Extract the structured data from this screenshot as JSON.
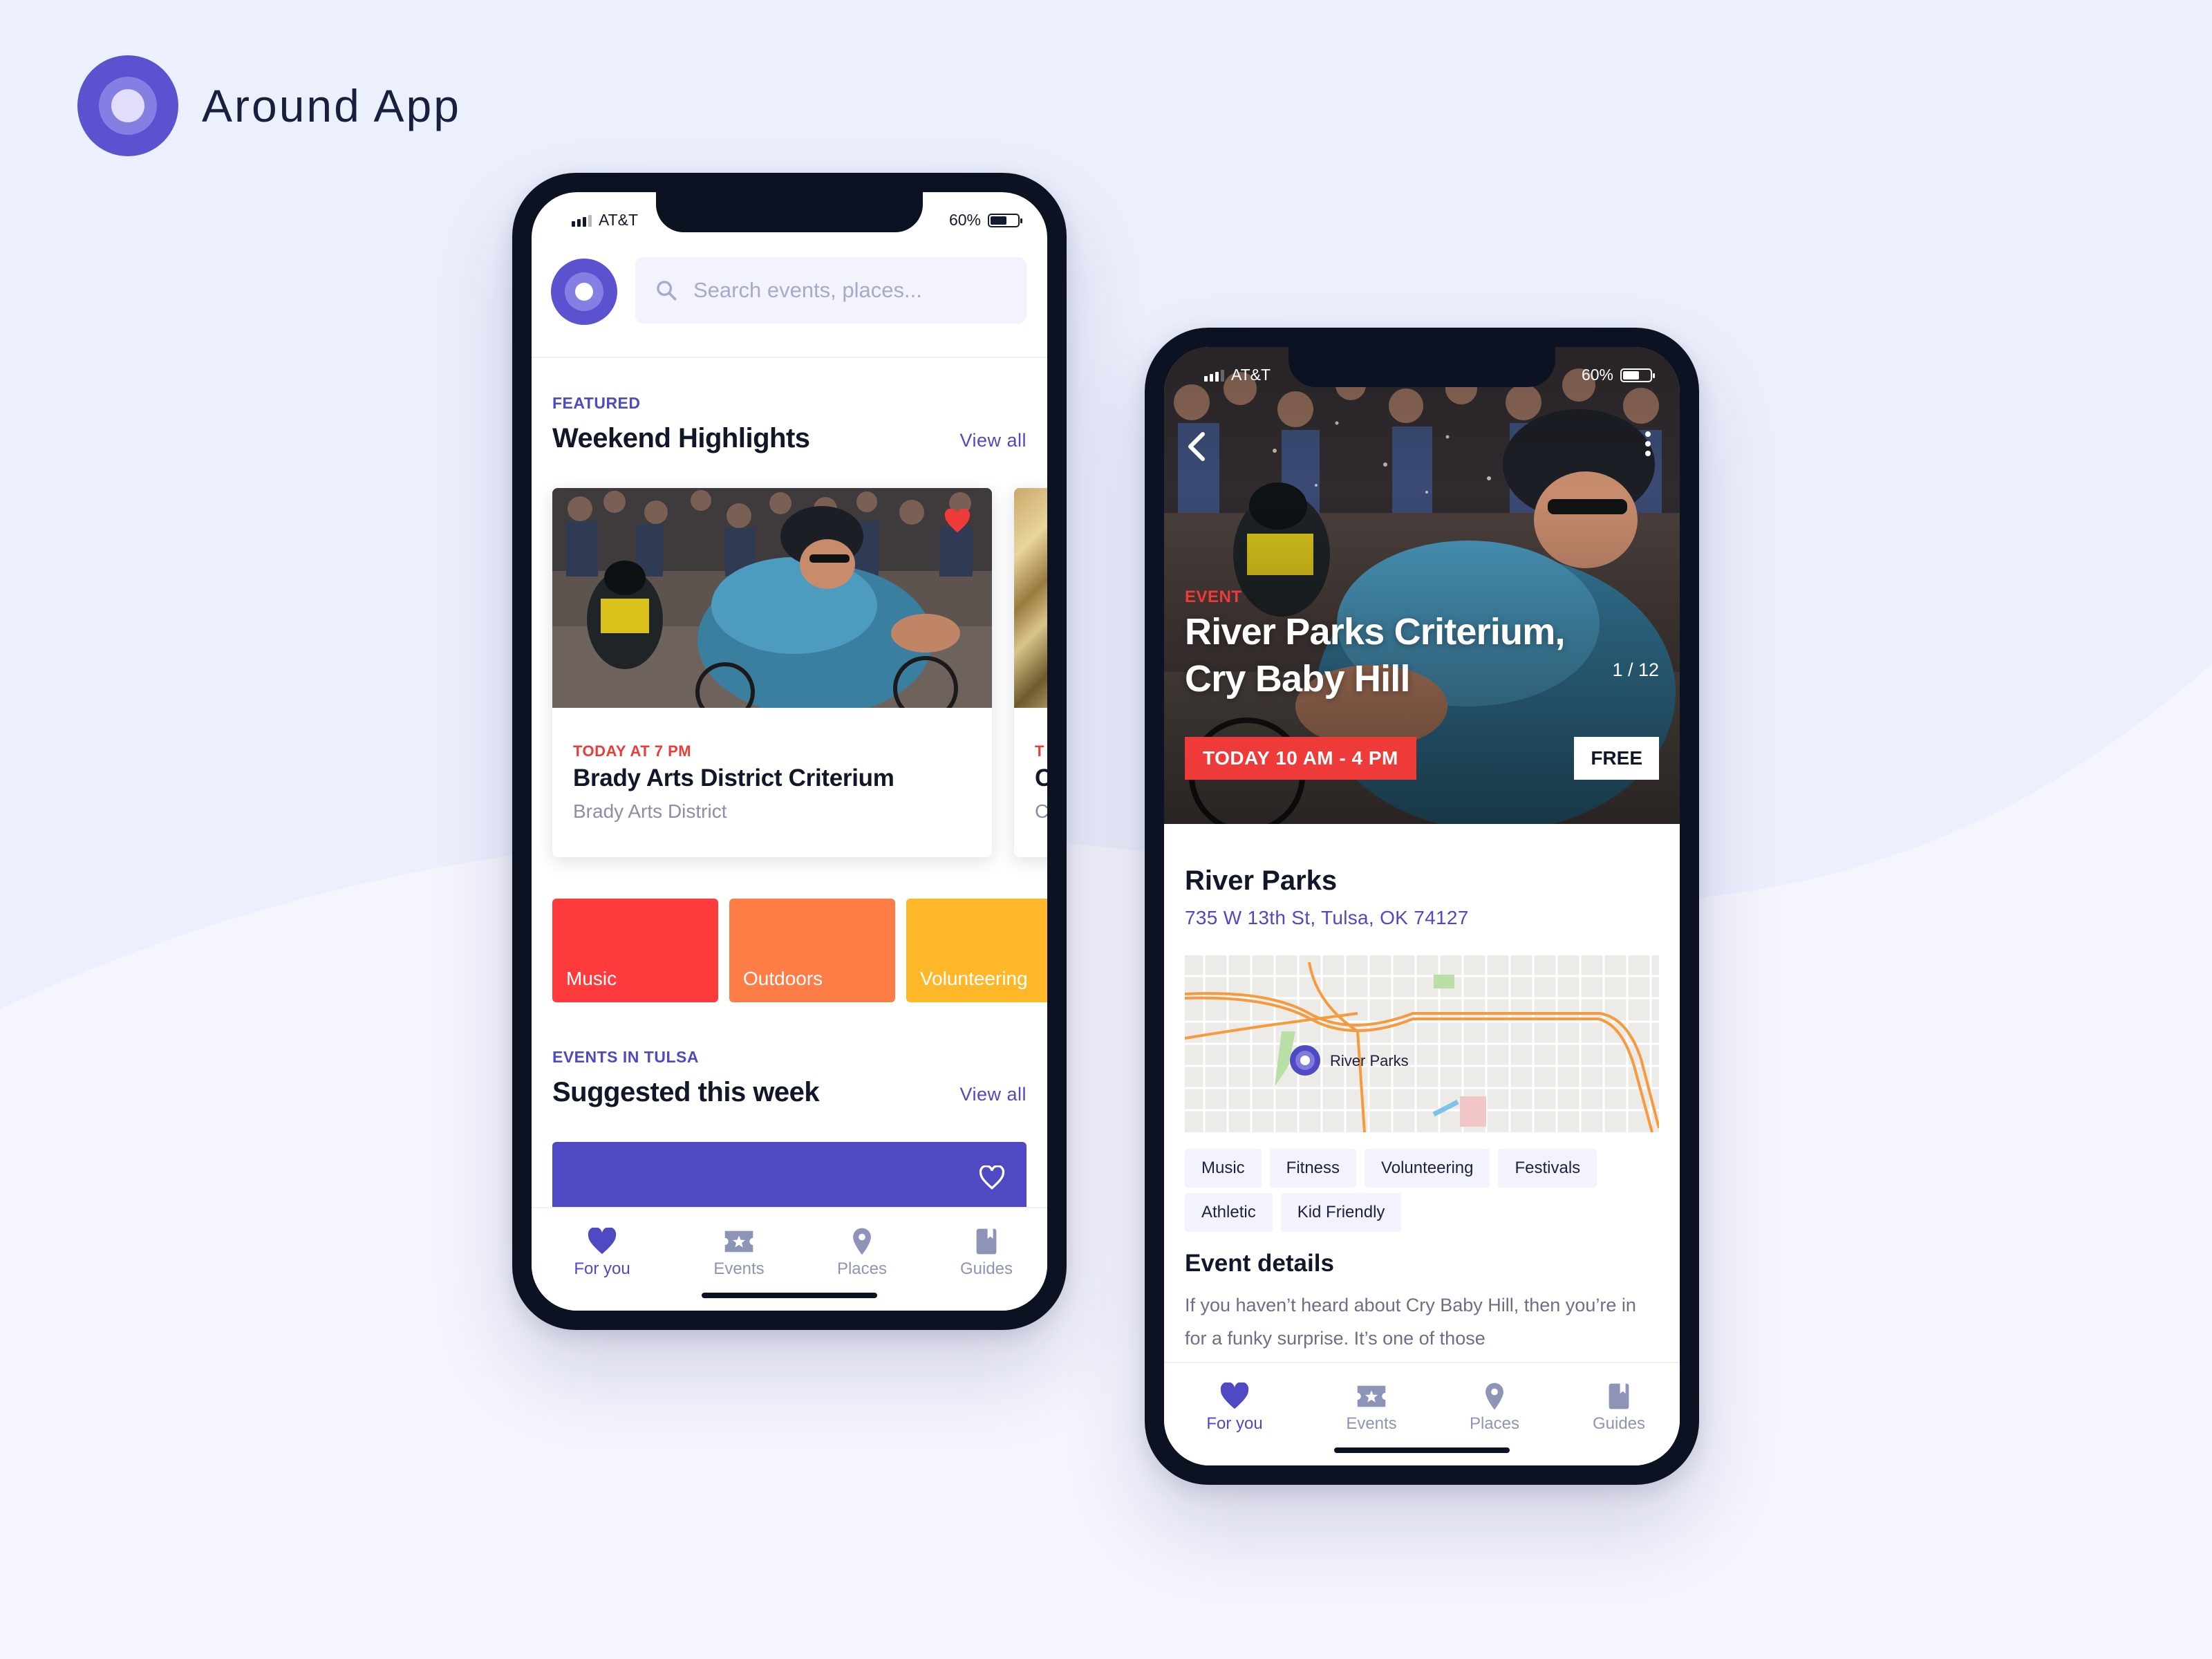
{
  "brand": {
    "name": "Around App"
  },
  "colors": {
    "accent": "#4f49c4",
    "red": "#ef3a3a",
    "orange": "#fe7c45",
    "yellow": "#fdb728",
    "text": "#111629"
  },
  "status_bar": {
    "carrier": "AT&T",
    "battery": "60%"
  },
  "home": {
    "search_placeholder": "Search events, places...",
    "featured": {
      "eyebrow": "FEATURED",
      "title": "Weekend Highlights",
      "view_all": "View all",
      "cards": [
        {
          "when": "TODAY AT 7 PM",
          "title": "Brady Arts District Criterium",
          "location": "Brady Arts District",
          "favorited": true
        },
        {
          "when": "T",
          "title": "C",
          "location": "C"
        }
      ]
    },
    "categories": [
      {
        "label": "Music",
        "color": "#fe3a3d"
      },
      {
        "label": "Outdoors",
        "color": "#fe7c45"
      },
      {
        "label": "Volunteering",
        "color": "#fdb728"
      }
    ],
    "suggested": {
      "eyebrow": "EVENTS IN TULSA",
      "title": "Suggested this week",
      "view_all": "View all"
    }
  },
  "tabs": [
    {
      "label": "For you",
      "icon": "heart-icon",
      "active": true
    },
    {
      "label": "Events",
      "icon": "ticket-icon",
      "active": false
    },
    {
      "label": "Places",
      "icon": "location-pin-icon",
      "active": false
    },
    {
      "label": "Guides",
      "icon": "bookmark-book-icon",
      "active": false
    }
  ],
  "detail": {
    "eyebrow": "EVENT",
    "title": "River Parks Criterium, Cry Baby Hill",
    "photo_counter": "1 / 12",
    "time": "TODAY 10 AM - 4 PM",
    "price": "FREE",
    "venue": "River Parks",
    "address": "735 W 13th St, Tulsa, OK 74127",
    "map_pin_label": "River Parks",
    "tags": [
      "Music",
      "Fitness",
      "Volunteering",
      "Festivals",
      "Athletic",
      "Kid Friendly"
    ],
    "details_title": "Event details",
    "details_text": "If you haven’t heard about Cry Baby Hill, then you’re in for a funky surprise. It’s one of those"
  }
}
